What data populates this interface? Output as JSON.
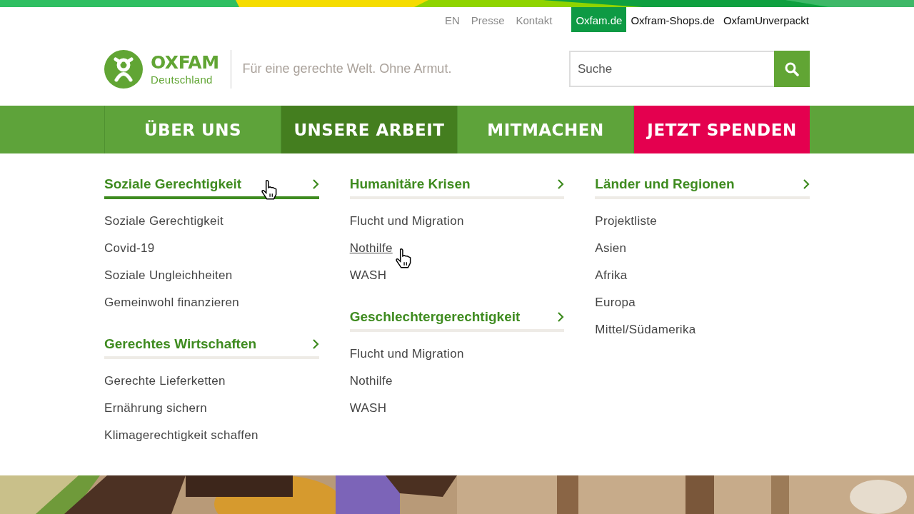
{
  "utility_links": [
    {
      "label": "EN"
    },
    {
      "label": "Presse"
    },
    {
      "label": "Kontakt"
    }
  ],
  "site_links": [
    {
      "label": "Oxfam.de",
      "selected": true
    },
    {
      "label": "Oxfram-Shops.de",
      "selected": false
    },
    {
      "label": "OxfamUnverpackt",
      "selected": false
    }
  ],
  "logo": {
    "name": "OXFAM",
    "subtitle": "Deutschland"
  },
  "tagline": "Für eine gerechte Welt. Ohne Armut.",
  "search": {
    "placeholder": "Suche"
  },
  "main_nav": [
    {
      "label": "ÜBER UNS",
      "kind": "link",
      "selected": false
    },
    {
      "label": "UNSERE ARBEIT",
      "kind": "link",
      "selected": true
    },
    {
      "label": "MITMACHEN",
      "kind": "link",
      "selected": false
    },
    {
      "label": "JETZT SPENDEN",
      "kind": "donate",
      "selected": false
    }
  ],
  "menu_columns": [
    {
      "groups": [
        {
          "title": "Soziale Gerechtigkeit",
          "hovered": true,
          "items": [
            {
              "label": "Soziale Gerechtigkeit",
              "hovered": false
            },
            {
              "label": "Covid-19",
              "hovered": false
            },
            {
              "label": "Soziale Ungleichheiten",
              "hovered": false
            },
            {
              "label": "Gemeinwohl finanzieren",
              "hovered": false
            }
          ]
        },
        {
          "title": "Gerechtes Wirtschaften",
          "hovered": false,
          "items": [
            {
              "label": "Gerechte Lieferketten",
              "hovered": false
            },
            {
              "label": "Ernährung sichern",
              "hovered": false
            },
            {
              "label": "Klimagerechtigkeit schaffen",
              "hovered": false
            }
          ]
        }
      ]
    },
    {
      "groups": [
        {
          "title": "Humanitäre Krisen",
          "hovered": false,
          "items": [
            {
              "label": "Flucht und Migration",
              "hovered": false
            },
            {
              "label": "Nothilfe",
              "hovered": true
            },
            {
              "label": "WASH",
              "hovered": false
            }
          ]
        },
        {
          "title": "Geschlechtergerechtigkeit",
          "hovered": false,
          "items": [
            {
              "label": "Flucht und Migration",
              "hovered": false
            },
            {
              "label": "Nothilfe",
              "hovered": false
            },
            {
              "label": "WASH",
              "hovered": false
            }
          ]
        }
      ]
    },
    {
      "groups": [
        {
          "title": "Länder und Regionen",
          "hovered": false,
          "items": [
            {
              "label": "Projektliste",
              "hovered": false
            },
            {
              "label": "Asien",
              "hovered": false
            },
            {
              "label": "Afrika",
              "hovered": false
            },
            {
              "label": "Europa",
              "hovered": false
            },
            {
              "label": "Mittel/Südamerika",
              "hovered": false
            }
          ]
        }
      ]
    }
  ]
}
